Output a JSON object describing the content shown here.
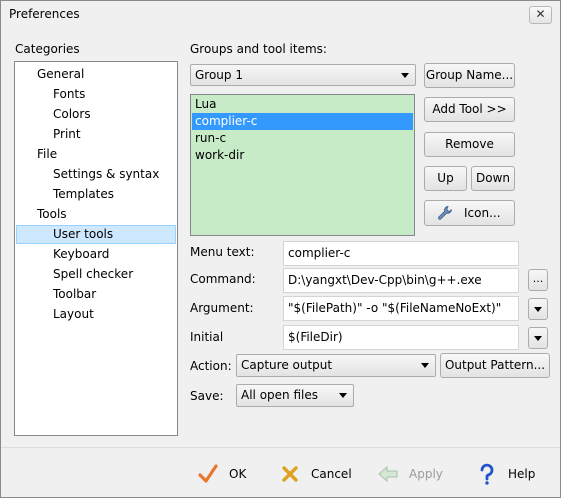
{
  "window": {
    "title": "Preferences",
    "close_symbol": "✕"
  },
  "categories": {
    "heading": "Categories",
    "items": [
      {
        "label": "General"
      },
      {
        "label": "Fonts"
      },
      {
        "label": "Colors"
      },
      {
        "label": "Print"
      },
      {
        "label": "File"
      },
      {
        "label": "Settings & syntax"
      },
      {
        "label": "Templates"
      },
      {
        "label": "Tools"
      },
      {
        "label": "User tools",
        "selected": true
      },
      {
        "label": "Keyboard"
      },
      {
        "label": "Spell checker"
      },
      {
        "label": "Toolbar"
      },
      {
        "label": "Layout"
      }
    ]
  },
  "groups": {
    "heading": "Groups and tool items:",
    "selected_group": "Group 1",
    "items": [
      "Lua",
      "complier-c",
      "run-c",
      "work-dir"
    ],
    "selected_index": 1
  },
  "buttons": {
    "group_name": "Group Name...",
    "add_tool": "Add Tool >>",
    "remove": "Remove",
    "up": "Up",
    "down": "Down",
    "icon": "Icon...",
    "browse": "...",
    "output_pattern": "Output Pattern..."
  },
  "fields": {
    "menu_text_label": "Menu text:",
    "menu_text_value": "complier-c",
    "command_label": "Command:",
    "command_value": "D:\\yangxt\\Dev-Cpp\\bin\\g++.exe",
    "argument_label": "Argument:",
    "argument_value": "\"$(FilePath)\" -o \"$(FileNameNoExt)\"",
    "initial_label": "Initial",
    "initial_value": "$(FileDir)",
    "action_label": "Action:",
    "action_value": "Capture output",
    "save_label": "Save:",
    "save_value": "All open files"
  },
  "footer": {
    "ok": "OK",
    "cancel": "Cancel",
    "apply": "Apply",
    "help": "Help"
  },
  "colors": {
    "list_background": "#c7eac7",
    "selection": "#3399ff",
    "ok_check": "#e8772e",
    "cancel_x": "#e0a020",
    "help_icon": "#2255cc"
  }
}
